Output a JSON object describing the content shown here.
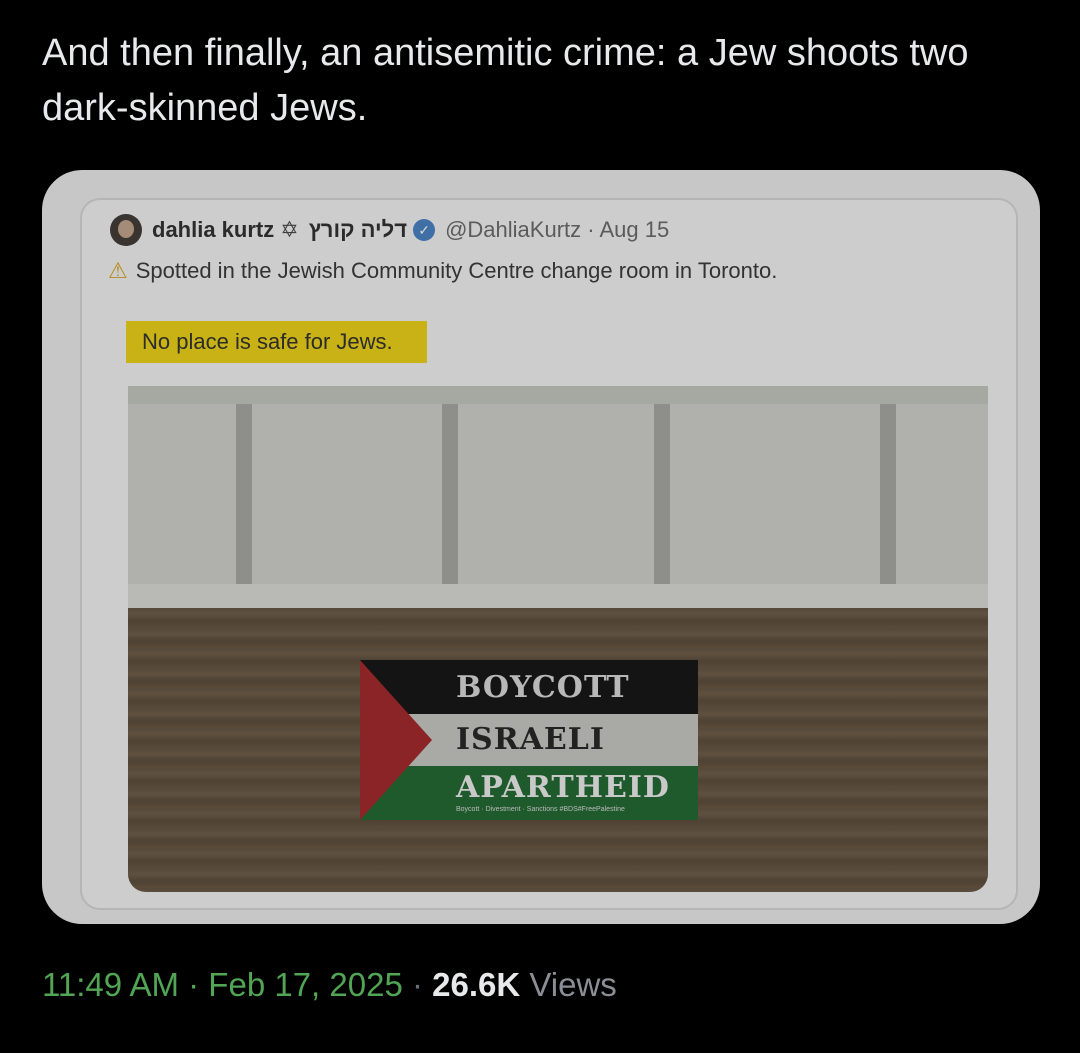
{
  "tweet": {
    "text": "And then finally, an antisemitic crime: a Jew shoots two dark-skinned Jews."
  },
  "quoted_tweet": {
    "author_name": "dahlia kurtz",
    "star_symbol": "✡",
    "hebrew_name": "דליה קורץ",
    "handle_date": "@DahliaKurtz · Aug 15",
    "warning_icon": "warning-icon",
    "line1": "Spotted in the Jewish Community Centre change room in Toronto.",
    "highlight_text": "No place is safe for Jews.",
    "sticker": {
      "line1": "BOYCOTT",
      "line2": "ISRAELI",
      "line3": "APARTHEID",
      "small_print": "Boycott · Divestment · Sanctions #BDS#FreePalestine"
    }
  },
  "footer": {
    "time": "11:49 AM · Feb 17, 2025",
    "separator": " · ",
    "views_count": "26.6K",
    "views_label": " Views"
  },
  "colors": {
    "background": "#000000",
    "text": "#e7e9ea",
    "timestamp": "#51a554",
    "highlight": "#c8b215",
    "verified": "#3f6fa5"
  }
}
